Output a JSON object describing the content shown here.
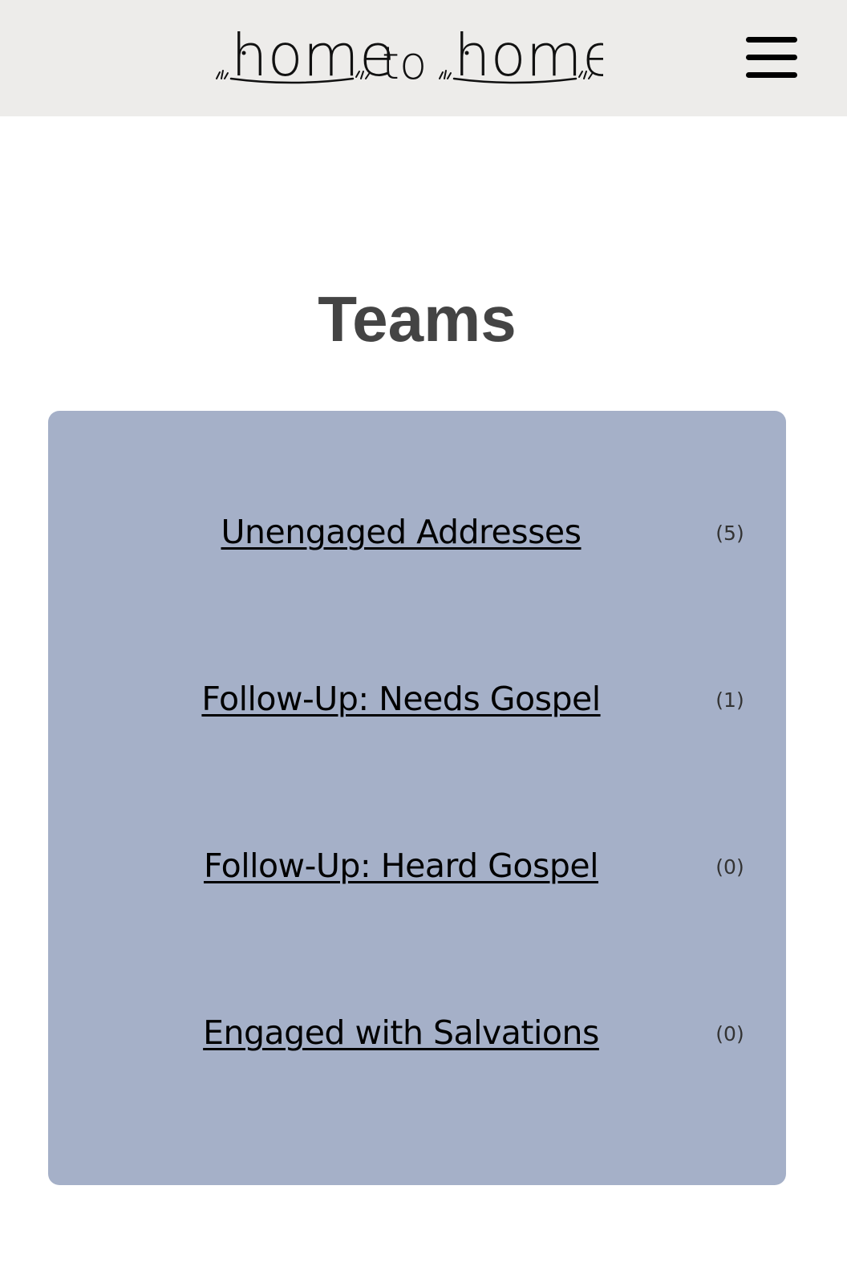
{
  "header": {
    "logo": {
      "word_left": "home",
      "word_middle": "to",
      "word_right": "home",
      "icon": "home-to-home-logo"
    },
    "menu_icon": "hamburger-menu-icon"
  },
  "main": {
    "title": "Teams",
    "panel_color": "#a5b0c8",
    "teams": [
      {
        "label": "Unengaged Addresses",
        "count": "(5)"
      },
      {
        "label": "Follow-Up: Needs Gospel",
        "count": "(1)"
      },
      {
        "label": "Follow-Up: Heard Gospel",
        "count": "(0)"
      },
      {
        "label": "Engaged with Salvations",
        "count": "(0)"
      }
    ]
  }
}
